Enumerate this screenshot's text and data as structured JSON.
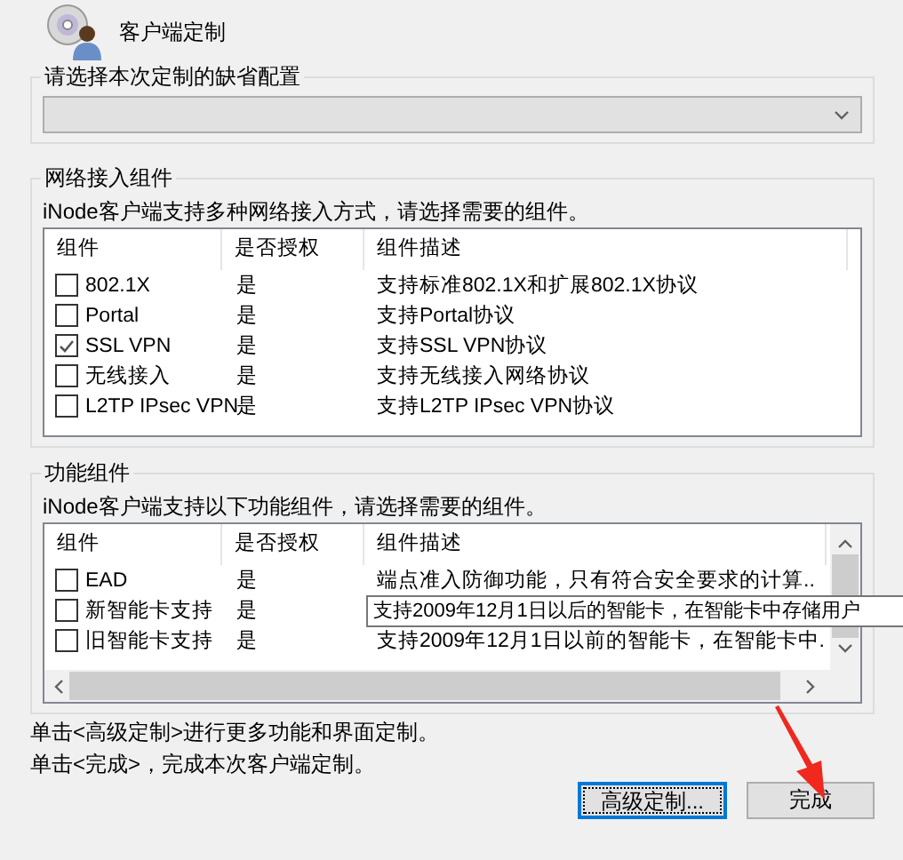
{
  "header": {
    "title": "客户端定制"
  },
  "default_config": {
    "legend": "请选择本次定制的缺省配置",
    "dropdown": {
      "disabled": true
    }
  },
  "network_group": {
    "legend": "网络接入组件",
    "description": "iNode客户端支持多种网络接入方式，请选择需要的组件。",
    "columns": [
      "组件",
      "是否授权",
      "组件描述"
    ],
    "rows": [
      {
        "name": "802.1X",
        "licensed": "是",
        "description": "支持标准802.1X和扩展802.1X协议",
        "checked": false
      },
      {
        "name": "Portal",
        "licensed": "是",
        "description": "支持Portal协议",
        "checked": false
      },
      {
        "name": "SSL VPN",
        "licensed": "是",
        "description": "支持SSL VPN协议",
        "checked": true
      },
      {
        "name": "无线接入",
        "licensed": "是",
        "description": "支持无线接入网络协议",
        "checked": false
      },
      {
        "name": "L2TP IPsec VPN",
        "licensed": "是",
        "description": "支持L2TP IPsec VPN协议",
        "checked": false
      }
    ]
  },
  "feature_group": {
    "legend": "功能组件",
    "description": "iNode客户端支持以下功能组件，请选择需要的组件。",
    "columns": [
      "组件",
      "是否授权",
      "组件描述"
    ],
    "rows": [
      {
        "name": "EAD",
        "licensed": "是",
        "description": "端点准入防御功能，只有符合安全要求的计算..",
        "checked": false
      },
      {
        "name": "新智能卡支持",
        "licensed": "是",
        "checked": false
      },
      {
        "name": "旧智能卡支持",
        "licensed": "是",
        "description": "支持2009年12月1日以前的智能卡，在智能卡中.",
        "checked": false
      }
    ],
    "tooltip": {
      "text": "支持2009年12月1日以后的智能卡，在智能卡中存储用户"
    }
  },
  "hints": [
    "单击<高级定制>进行更多功能和界面定制。",
    "单击<完成>，完成本次客户端定制。"
  ],
  "buttons": [
    {
      "label": "高级定制...",
      "focused": true
    },
    {
      "label": "完成",
      "focused": false
    }
  ]
}
